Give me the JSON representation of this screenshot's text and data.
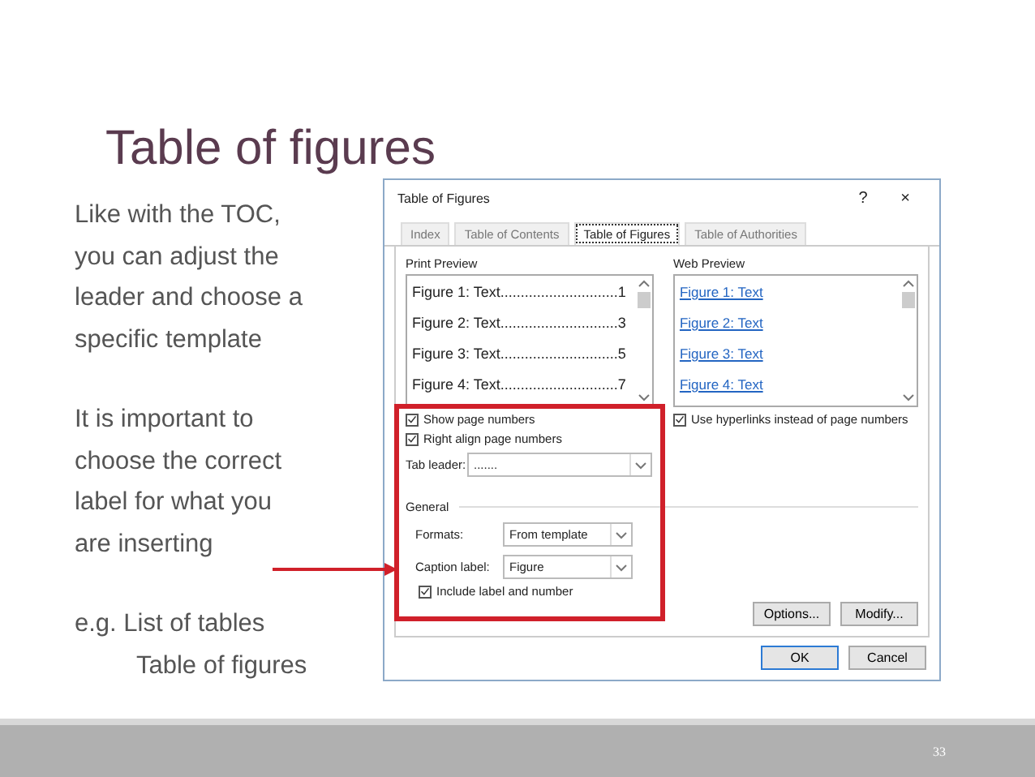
{
  "slide": {
    "title": "Table of figures",
    "paragraphs": [
      {
        "lines": [
          "Like with the TOC,",
          "you can adjust the",
          "leader and choose a",
          "specific template"
        ]
      },
      {
        "lines": [
          "It is important to",
          "choose the correct",
          "label for what you",
          "are inserting"
        ]
      },
      {
        "lines": [
          "e.g. List of tables",
          "Table of figures"
        ]
      }
    ],
    "page_number": "33"
  },
  "dialog": {
    "title": "Table of Figures",
    "help": "?",
    "close": "×",
    "tabs": [
      {
        "label": "Index",
        "selected": false
      },
      {
        "label": "Table of Contents",
        "selected": false
      },
      {
        "label": "Table of Figures",
        "selected": true
      },
      {
        "label": "Table of Authorities",
        "selected": false
      }
    ],
    "print_preview": {
      "label": "Print Preview",
      "entries": [
        "Figure 1: Text.............................1",
        "Figure 2: Text.............................3",
        "Figure 3: Text.............................5",
        "Figure 4: Text.............................7"
      ]
    },
    "web_preview": {
      "label": "Web Preview",
      "entries": [
        "Figure 1: Text",
        "Figure 2: Text",
        "Figure 3: Text",
        "Figure 4: Text"
      ]
    },
    "left_checks": [
      {
        "label": "Show page numbers",
        "checked": true
      },
      {
        "label": "Right align page numbers",
        "checked": true
      }
    ],
    "right_check": {
      "label": "Use hyperlinks instead of page numbers",
      "checked": true
    },
    "tab_leader": {
      "label": "Tab leader:",
      "value": "......."
    },
    "general": {
      "label": "General",
      "fields": [
        {
          "label": "Formats:",
          "value": "From template"
        },
        {
          "label": "Caption label:",
          "value": "Figure"
        }
      ],
      "include": {
        "label": "Include label and number",
        "checked": true
      }
    },
    "side_buttons": [
      "Options...",
      "Modify..."
    ],
    "buttons": [
      {
        "label": "OK",
        "default": true
      },
      {
        "label": "Cancel",
        "default": false
      }
    ]
  }
}
